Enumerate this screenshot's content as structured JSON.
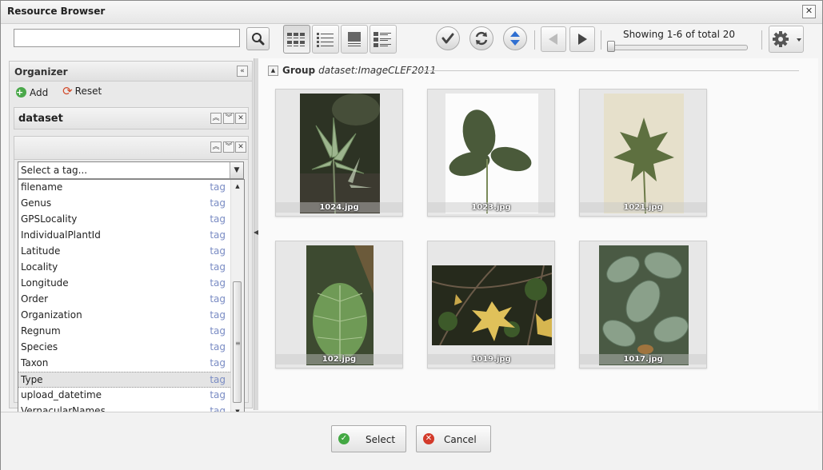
{
  "window": {
    "title": "Resource Browser",
    "close_glyph": "✕"
  },
  "toolbar": {
    "search": {
      "value": "",
      "placeholder": ""
    },
    "showing_text": "Showing 1-6 of total 20",
    "icons": [
      "search-icon",
      "view-thumbnails-icon",
      "view-list-icon",
      "view-detail-icon",
      "view-table-icon",
      "check-icon",
      "refresh-icon",
      "sort-icon",
      "prev-page-icon",
      "next-page-icon",
      "settings-icon"
    ],
    "slider_value": 0
  },
  "organizer": {
    "title": "Organizer",
    "add_label": "Add",
    "reset_label": "Reset",
    "facet1_label": "dataset",
    "tag_select_placeholder": "Select a tag...",
    "tags": [
      {
        "name": "filename",
        "type": "tag"
      },
      {
        "name": "Genus",
        "type": "tag"
      },
      {
        "name": "GPSLocality",
        "type": "tag"
      },
      {
        "name": "IndividualPlantId",
        "type": "tag"
      },
      {
        "name": "Latitude",
        "type": "tag"
      },
      {
        "name": "Locality",
        "type": "tag"
      },
      {
        "name": "Longitude",
        "type": "tag"
      },
      {
        "name": "Order",
        "type": "tag"
      },
      {
        "name": "Organization",
        "type": "tag"
      },
      {
        "name": "Regnum",
        "type": "tag"
      },
      {
        "name": "Species",
        "type": "tag"
      },
      {
        "name": "Taxon",
        "type": "tag"
      },
      {
        "name": "Type",
        "type": "tag"
      },
      {
        "name": "upload_datetime",
        "type": "tag"
      },
      {
        "name": "VernacularNames",
        "type": "tag"
      }
    ],
    "selected_tag": "Type"
  },
  "content": {
    "group_label": "Group",
    "group_value": "dataset:ImageCLEF2011",
    "images": [
      {
        "caption": "1024.jpg"
      },
      {
        "caption": "1023.jpg"
      },
      {
        "caption": "1021.jpg"
      },
      {
        "caption": "102.jpg"
      },
      {
        "caption": "1019.jpg"
      },
      {
        "caption": "1017.jpg"
      }
    ]
  },
  "footer": {
    "select_label": "Select",
    "cancel_label": "Cancel"
  }
}
